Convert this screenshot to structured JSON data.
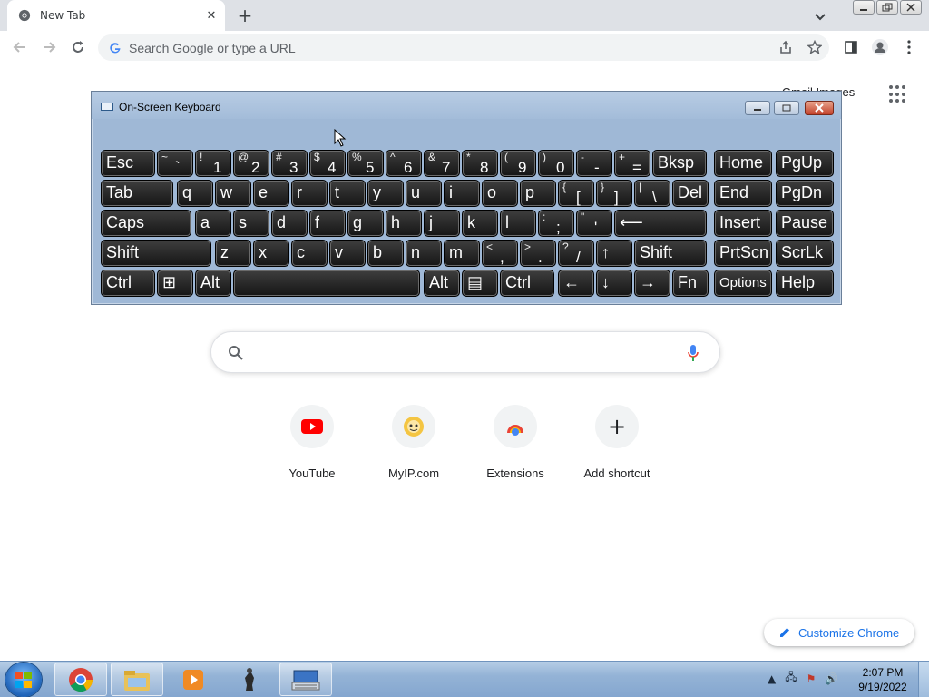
{
  "browser": {
    "tab_title": "New Tab",
    "new_tab_symbol": "+",
    "close_symbol": "✕",
    "omnibox_placeholder": "Search Google or type a URL",
    "accent_color": "#1a73e8"
  },
  "ntp": {
    "gmail_images_text": "Gmail  Images",
    "shortcuts": [
      {
        "label": "YouTube",
        "icon": "youtube-icon"
      },
      {
        "label": "MyIP.com",
        "icon": "myip-icon"
      },
      {
        "label": "Extensions",
        "icon": "extensions-icon"
      },
      {
        "label": "Add shortcut",
        "icon": "plus-icon"
      }
    ],
    "add_symbol": "+",
    "customize_label": "Customize Chrome"
  },
  "osk": {
    "title": "On-Screen Keyboard",
    "rows": [
      [
        {
          "main": "Esc"
        },
        {
          "shift": "~",
          "base": "`"
        },
        {
          "shift": "!",
          "base": "1"
        },
        {
          "shift": "@",
          "base": "2"
        },
        {
          "shift": "#",
          "base": "3"
        },
        {
          "shift": "$",
          "base": "4"
        },
        {
          "shift": "%",
          "base": "5"
        },
        {
          "shift": "^",
          "base": "6"
        },
        {
          "shift": "&",
          "base": "7"
        },
        {
          "shift": "*",
          "base": "8"
        },
        {
          "shift": "(",
          "base": "9"
        },
        {
          "shift": ")",
          "base": "0"
        },
        {
          "shift": "-",
          "base": "-"
        },
        {
          "shift": "+",
          "base": "="
        },
        {
          "main": "Bksp"
        },
        {
          "main": "Home"
        },
        {
          "main": "PgUp"
        }
      ],
      [
        {
          "main": "Tab"
        },
        {
          "main": "q"
        },
        {
          "main": "w"
        },
        {
          "main": "e"
        },
        {
          "main": "r"
        },
        {
          "main": "t"
        },
        {
          "main": "y"
        },
        {
          "main": "u"
        },
        {
          "main": "i"
        },
        {
          "main": "o"
        },
        {
          "main": "p"
        },
        {
          "shift": "{",
          "base": "["
        },
        {
          "shift": "}",
          "base": "]"
        },
        {
          "shift": "|",
          "base": "\\"
        },
        {
          "main": "Del"
        },
        {
          "main": "End"
        },
        {
          "main": "PgDn"
        }
      ],
      [
        {
          "main": "Caps"
        },
        {
          "main": "a"
        },
        {
          "main": "s"
        },
        {
          "main": "d"
        },
        {
          "main": "f"
        },
        {
          "main": "g"
        },
        {
          "main": "h"
        },
        {
          "main": "j"
        },
        {
          "main": "k"
        },
        {
          "main": "l"
        },
        {
          "shift": ":",
          "base": ";"
        },
        {
          "shift": "\"",
          "base": "'"
        },
        {
          "main": "⟵"
        },
        {
          "main": "Insert"
        },
        {
          "main": "Pause"
        }
      ],
      [
        {
          "main": "Shift"
        },
        {
          "main": "z"
        },
        {
          "main": "x"
        },
        {
          "main": "c"
        },
        {
          "main": "v"
        },
        {
          "main": "b"
        },
        {
          "main": "n"
        },
        {
          "main": "m"
        },
        {
          "shift": "<",
          "base": ","
        },
        {
          "shift": ">",
          "base": "."
        },
        {
          "shift": "?",
          "base": "/"
        },
        {
          "main": "↑"
        },
        {
          "main": "Shift"
        },
        {
          "main": "PrtScn"
        },
        {
          "main": "ScrLk"
        }
      ],
      [
        {
          "main": "Ctrl"
        },
        {
          "main": "⊞"
        },
        {
          "main": "Alt"
        },
        {
          "main": ""
        },
        {
          "main": "Alt"
        },
        {
          "main": "▤"
        },
        {
          "main": "Ctrl"
        },
        {
          "main": "←"
        },
        {
          "main": "↓"
        },
        {
          "main": "→"
        },
        {
          "main": "Fn"
        },
        {
          "main": "Options"
        },
        {
          "main": "Help"
        }
      ]
    ]
  },
  "taskbar": {
    "time": "2:07 PM",
    "date": "9/19/2022",
    "apps": [
      "chrome-icon",
      "file-explorer-icon",
      "media-player-icon",
      "chess-icon",
      "on-screen-keyboard-icon"
    ]
  }
}
